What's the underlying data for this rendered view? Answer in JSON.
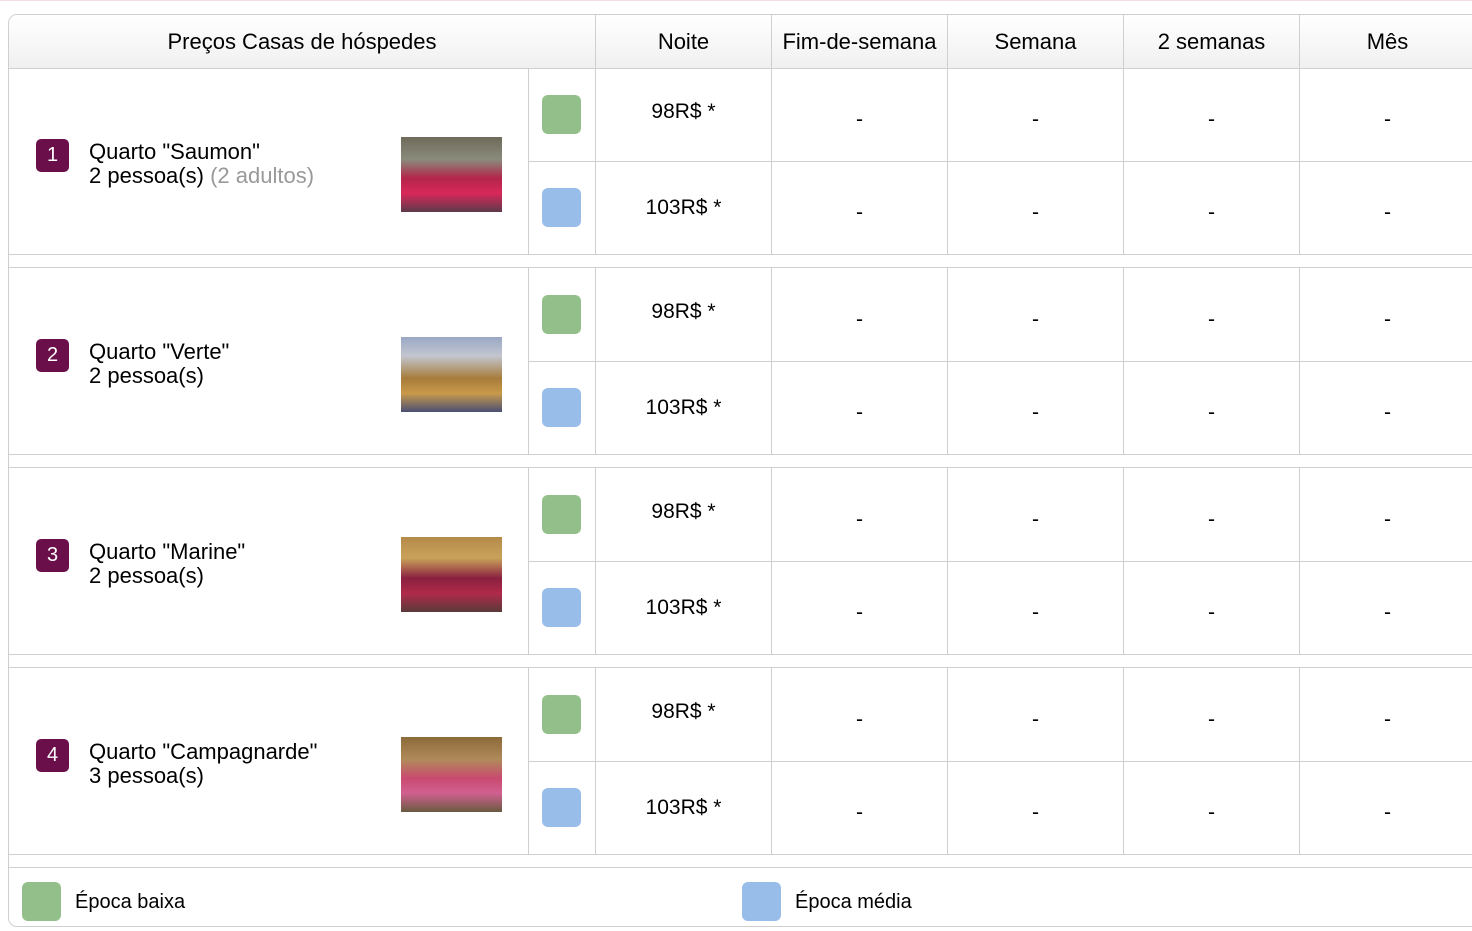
{
  "header": {
    "title": "Preços Casas de hóspedes",
    "columns": [
      "Noite",
      "Fim-de-semana",
      "Semana",
      "2 semanas",
      "Mês"
    ]
  },
  "colors": {
    "low": "#93c08a",
    "mid": "#99bde9",
    "badge": "#6b0f4a"
  },
  "rooms": [
    {
      "num": "1",
      "name": "Quarto \"Saumon\"",
      "capacity": "2 pessoa(s)",
      "extra": "(2 adultos)",
      "photo": "bedroom-photo-saumon",
      "prices": [
        {
          "season": "low",
          "noite": "98R$ *",
          "other": [
            "-",
            "-",
            "-",
            "-"
          ]
        },
        {
          "season": "mid",
          "noite": "103R$ *",
          "other": [
            "-",
            "-",
            "-",
            "-"
          ]
        }
      ]
    },
    {
      "num": "2",
      "name": "Quarto \"Verte\"",
      "capacity": "2 pessoa(s)",
      "extra": "",
      "photo": "bedroom-photo-verte",
      "prices": [
        {
          "season": "low",
          "noite": "98R$ *",
          "other": [
            "-",
            "-",
            "-",
            "-"
          ]
        },
        {
          "season": "mid",
          "noite": "103R$ *",
          "other": [
            "-",
            "-",
            "-",
            "-"
          ]
        }
      ]
    },
    {
      "num": "3",
      "name": "Quarto \"Marine\"",
      "capacity": "2 pessoa(s)",
      "extra": "",
      "photo": "bedroom-photo-marine",
      "prices": [
        {
          "season": "low",
          "noite": "98R$ *",
          "other": [
            "-",
            "-",
            "-",
            "-"
          ]
        },
        {
          "season": "mid",
          "noite": "103R$ *",
          "other": [
            "-",
            "-",
            "-",
            "-"
          ]
        }
      ]
    },
    {
      "num": "4",
      "name": "Quarto \"Campagnarde\"",
      "capacity": "3 pessoa(s)",
      "extra": "",
      "photo": "bedroom-photo-campagnarde",
      "prices": [
        {
          "season": "low",
          "noite": "98R$ *",
          "other": [
            "-",
            "-",
            "-",
            "-"
          ]
        },
        {
          "season": "mid",
          "noite": "103R$ *",
          "other": [
            "-",
            "-",
            "-",
            "-"
          ]
        }
      ]
    }
  ],
  "legend": {
    "low_label": "Época baixa",
    "mid_label": "Época média"
  }
}
